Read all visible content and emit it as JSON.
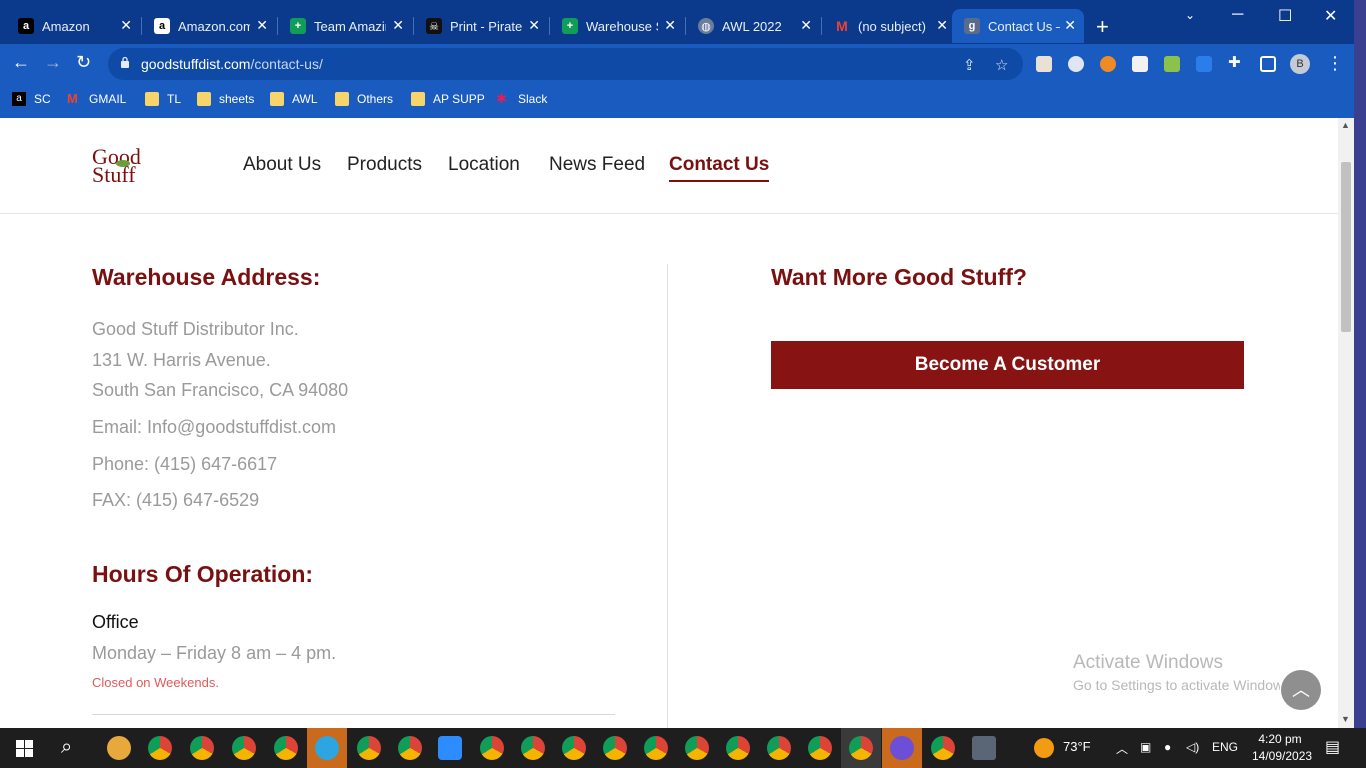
{
  "browser": {
    "tabs": [
      {
        "title": "Amazon",
        "icon": "amazon-icon"
      },
      {
        "title": "Amazon.com",
        "icon": "amazon-icon"
      },
      {
        "title": "Team Amazin",
        "icon": "sheets-icon"
      },
      {
        "title": "Print - Pirate",
        "icon": "pirate-icon"
      },
      {
        "title": "Warehouse S",
        "icon": "sheets-icon"
      },
      {
        "title": "AWL 2022",
        "icon": "globe-icon"
      },
      {
        "title": "(no subject) -",
        "icon": "gmail-icon"
      },
      {
        "title": "Contact Us –",
        "icon": "site-icon"
      }
    ],
    "url_host": "goodstuffdist.com",
    "url_path": "/contact-us/",
    "bookmarks": [
      "SC",
      "GMAIL",
      "TL",
      "sheets",
      "AWL",
      "Others",
      "AP SUPP",
      "Slack"
    ],
    "profile_initial": "B"
  },
  "site": {
    "logo_top": "Good",
    "logo_bottom": "Stuff",
    "nav": [
      "About Us",
      "Products",
      "Location",
      "News Feed",
      "Contact Us"
    ],
    "warehouse_heading": "Warehouse Address:",
    "address_lines": [
      "Good Stuff Distributor Inc.",
      "131 W. Harris Avenue.",
      "South San Francisco, CA 94080"
    ],
    "email": "Email: Info@goodstuffdist.com",
    "phone": "Phone: (415) 647-6617",
    "fax": "FAX: (415) 647-6529",
    "hours_heading": "Hours Of Operation:",
    "office_label": "Office",
    "office_hours": "Monday – Friday 8 am – 4 pm.",
    "closed_note": "Closed on Weekends.",
    "want_more_heading": "Want More Good Stuff?",
    "cta_label": "Become A Customer",
    "brand_color": "#7a1010"
  },
  "overlay": {
    "activate_title": "Activate Windows",
    "activate_sub": "Go to Settings to activate Windows."
  },
  "taskbar": {
    "weather": "73°F",
    "lang": "ENG",
    "time": "4:20 pm",
    "date": "14/09/2023"
  }
}
